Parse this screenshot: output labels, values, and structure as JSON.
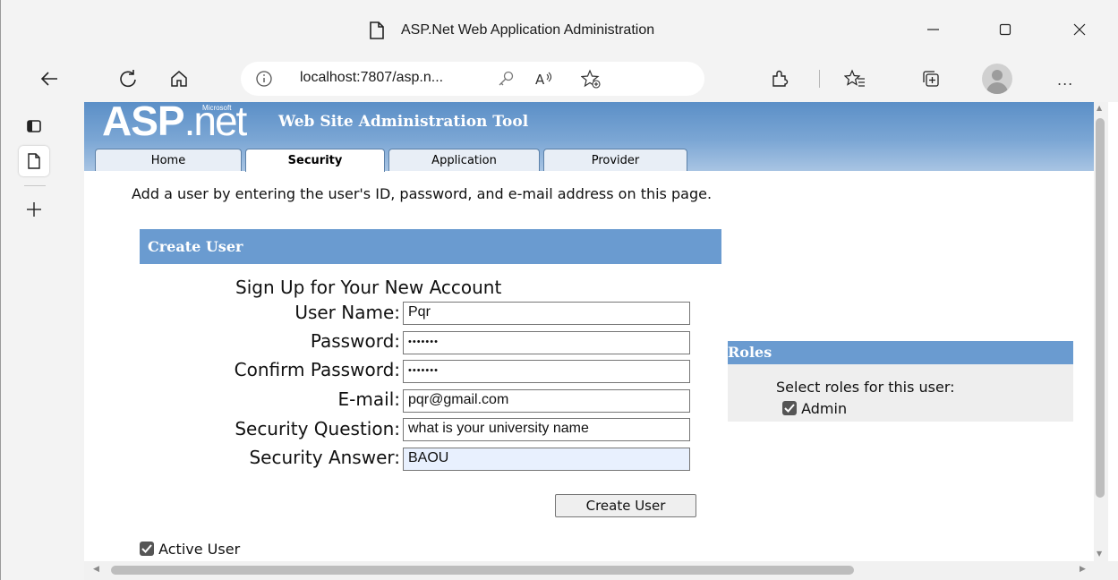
{
  "window": {
    "title": "ASP.Net Web Application Administration"
  },
  "browser": {
    "url": "localhost:7807/asp.n...",
    "more_label": "..."
  },
  "header": {
    "logo_asp": "ASP",
    "logo_net": ".net",
    "logo_microsoft": "Microsoft",
    "tool_title": "Web Site Administration Tool",
    "tabs": [
      {
        "label": "Home"
      },
      {
        "label": "Security"
      },
      {
        "label": "Application"
      },
      {
        "label": "Provider"
      }
    ]
  },
  "main": {
    "intro": "Add a user by entering the user's ID, password, and e-mail address on this page."
  },
  "create_user": {
    "header": "Create User",
    "form_title": "Sign Up for Your New Account",
    "fields": [
      {
        "label": "User Name:",
        "value": "Pqr"
      },
      {
        "label": "Password:",
        "value": "•••••••"
      },
      {
        "label": "Confirm Password:",
        "value": "•••••••"
      },
      {
        "label": "E-mail:",
        "value": "pqr@gmail.com"
      },
      {
        "label": "Security Question:",
        "value": "what is your university name"
      },
      {
        "label": "Security Answer:",
        "value": "BAOU"
      }
    ],
    "submit_label": "Create User",
    "active_user_label": "Active User",
    "active_user_checked": true
  },
  "roles": {
    "header": "Roles",
    "prompt": "Select roles for this user:",
    "items": [
      {
        "label": "Admin",
        "checked": true
      }
    ]
  },
  "colors": {
    "section_header": "#6a9bd0",
    "header_gradient_top": "#5b8fc7",
    "autofill_bg": "#e8f0fe"
  }
}
